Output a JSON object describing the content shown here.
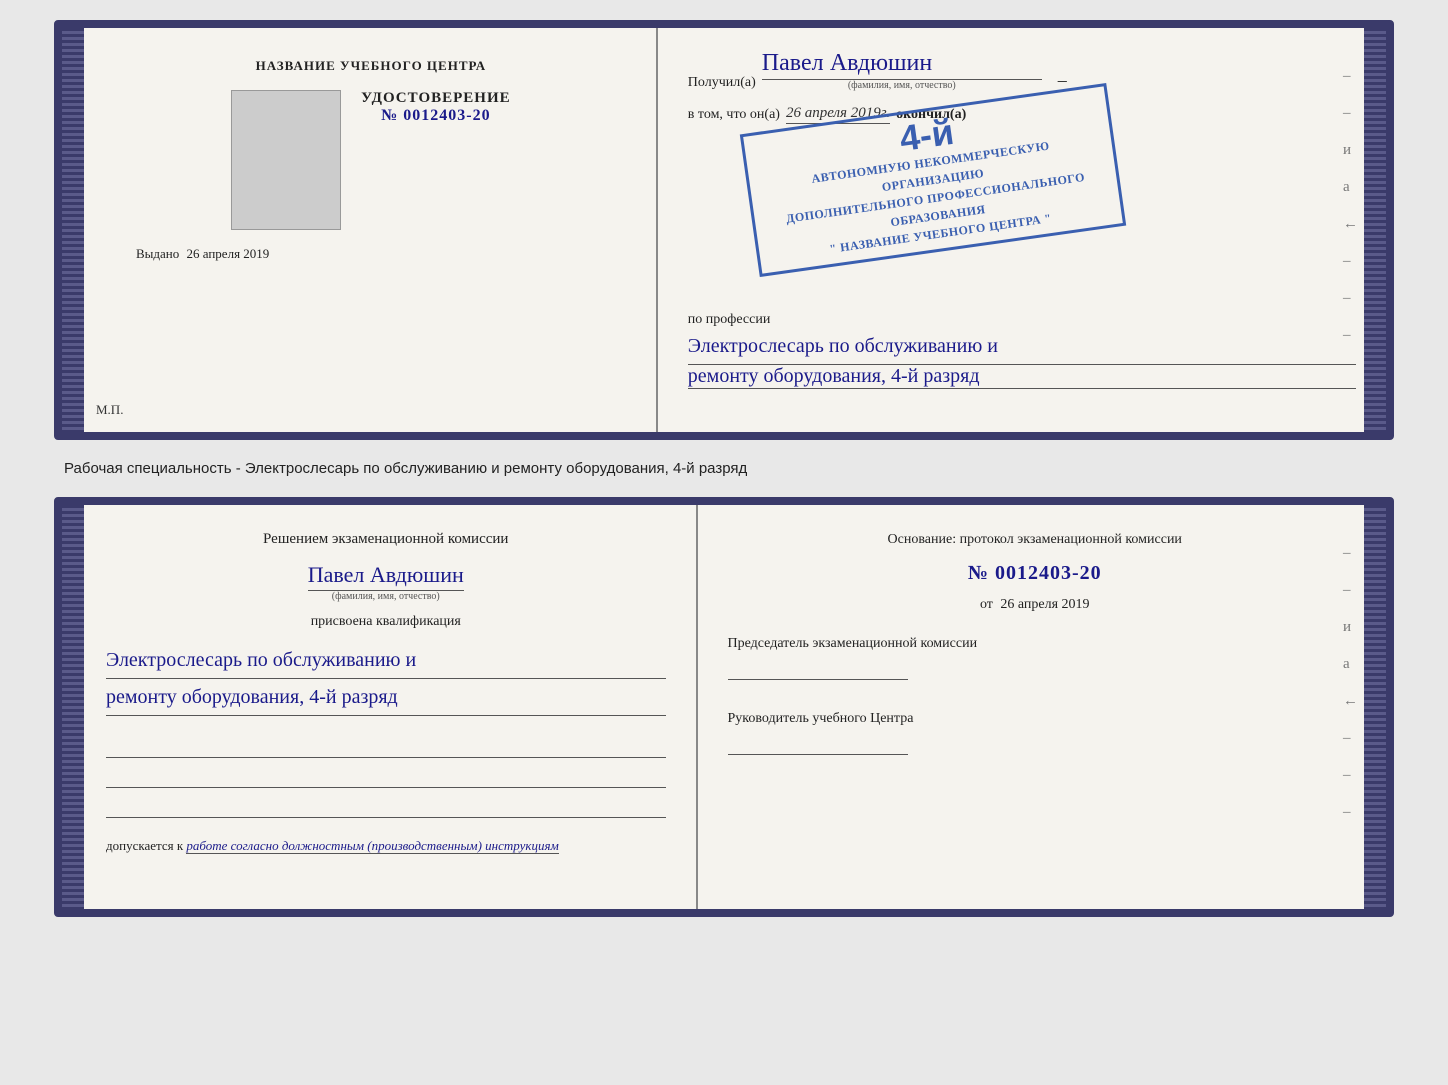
{
  "top_left": {
    "school_name": "НАЗВАНИЕ УЧЕБНОГО ЦЕНТРА",
    "udostoverenie_title": "УДОСТОВЕРЕНИЕ",
    "udostoverenie_num": "№ 0012403-20",
    "vydano_label": "Выдано",
    "vydano_date": "26 апреля 2019",
    "mp": "М.П."
  },
  "top_right": {
    "poluchil_label": "Получил(а)",
    "recipient_name": "Павел Авдюшин",
    "fio_label": "(фамилия, имя, отчество)",
    "vtom_label": "в том, что он(а)",
    "date_value": "26 апреля 2019г.",
    "okonchil_label": "окончил(а)",
    "stamp_rank": "4-й",
    "stamp_line1": "АВТОНОМНУЮ НЕКОММЕРЧЕСКУЮ ОРГАНИЗАЦИЮ",
    "stamp_line2": "ДОПОЛНИТЕЛЬНОГО ПРОФЕССИОНАЛЬНОГО ОБРАЗОВАНИЯ",
    "stamp_line3": "\" НАЗВАНИЕ УЧЕБНОГО ЦЕНТРА \"",
    "po_professii_label": "по профессии",
    "profession_line1": "Электрослесарь по обслуживанию и",
    "profession_line2": "ремонту оборудования, 4-й разряд"
  },
  "speciality_text": "Рабочая специальность - Электрослесарь по обслуживанию и ремонту оборудования, 4-й разряд",
  "bottom_left": {
    "resheniem_text": "Решением экзаменационной комиссии",
    "person_name": "Павел Авдюшин",
    "fio_label": "(фамилия, имя, отчество)",
    "prisvoena_label": "присвоена квалификация",
    "qualification_line1": "Электрослесарь по обслуживанию и",
    "qualification_line2": "ремонту оборудования, 4-й разряд",
    "dopuskaetsya_label": "допускается к",
    "dopuskaetsya_value": "работе согласно должностным (производственным) инструкциям"
  },
  "bottom_right": {
    "osnovanie_text": "Основание: протокол экзаменационной комиссии",
    "protocol_num": "№ 0012403-20",
    "ot_label": "от",
    "ot_date": "26 апреля 2019",
    "chairman_label": "Председатель экзаменационной комиссии",
    "rukovoditel_label": "Руководитель учебного Центра"
  },
  "dashes": [
    "-",
    "-",
    "и",
    "а",
    "←",
    "-",
    "-",
    "-",
    "-"
  ]
}
